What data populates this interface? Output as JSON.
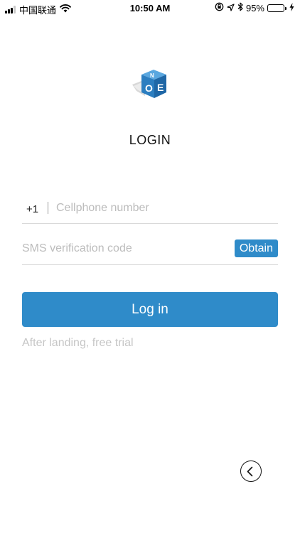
{
  "status_bar": {
    "carrier": "中国联通",
    "time": "10:50 AM",
    "battery_percent": "95%",
    "battery_level": 0.95,
    "icons": [
      "signal-icon",
      "wifi-icon",
      "rotation-lock-icon",
      "location-icon",
      "bluetooth-icon",
      "battery-icon",
      "charging-icon"
    ]
  },
  "header": {
    "logo_icon": "app-logo-cube-icon",
    "title": "LOGIN"
  },
  "form": {
    "country_code": "+1",
    "phone_placeholder": "Cellphone number",
    "phone_value": "",
    "sms_placeholder": "SMS verification code",
    "sms_value": "",
    "obtain_label": "Obtain",
    "login_label": "Log in",
    "hint": "After landing, free trial"
  },
  "navigation": {
    "back_icon": "back-circle-icon"
  },
  "colors": {
    "accent": "#2f8bc9",
    "placeholder": "#bcbcbc",
    "divider": "#d9d9d9",
    "battery": "#4cd964"
  }
}
